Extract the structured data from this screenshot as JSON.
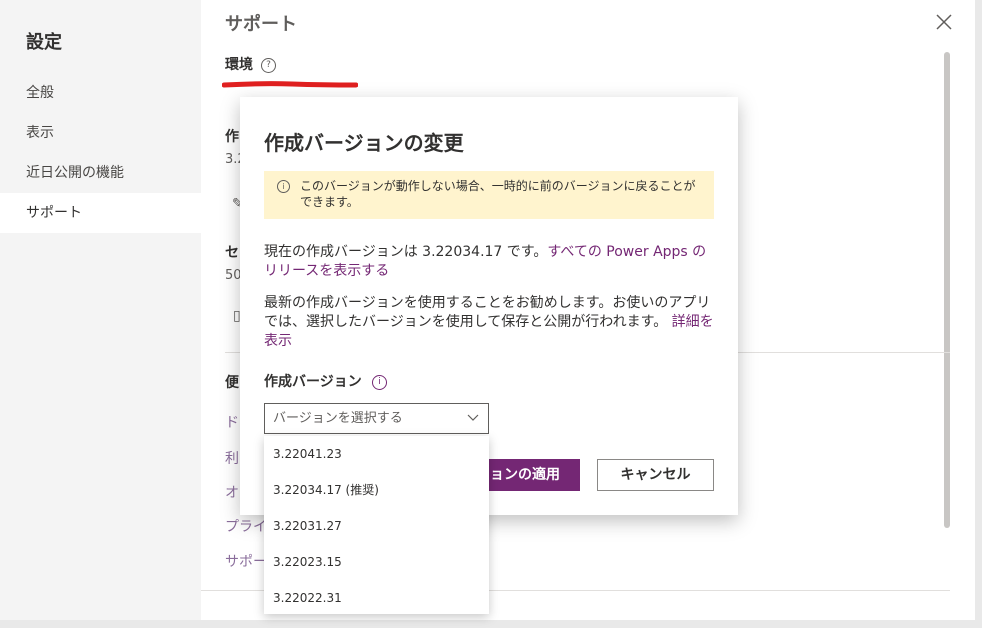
{
  "settings_nav": {
    "title": "設定",
    "items": [
      {
        "label": "全般"
      },
      {
        "label": "表示"
      },
      {
        "label": "近日公開の機能"
      },
      {
        "label": "サポート"
      }
    ]
  },
  "content": {
    "title": "サポート",
    "environment_label": "環境",
    "partial_texts": {
      "authoring": "作",
      "authoring_version": "3.2",
      "session": "セ",
      "session_value": "50",
      "useful": "便",
      "link_do": "ド",
      "link_ri": "利",
      "link_o": "オ",
      "link_privacy": "プライ",
      "link_support": "サポー"
    }
  },
  "dialog": {
    "title": "作成バージョンの変更",
    "warning_text": "このバージョンが動作しない場合、一時的に前のバージョンに戻ることができます。",
    "current_text": "現在の作成バージョンは 3.22034.17 です。",
    "release_link": "すべての Power Apps のリリースを表示する",
    "recommend_text": "最新の作成バージョンを使用することをお勧めします。お使いのアプリでは、選択したバージョンを使用して保存と公開が行われます。",
    "details_link": "詳細を表示",
    "field_label": "作成バージョン",
    "select_placeholder": "バージョンを選択する",
    "apply_label": "ョンの適用",
    "cancel_label": "キャンセル"
  },
  "dropdown_options": [
    {
      "label": "3.22041.23"
    },
    {
      "label": "3.22034.17 (推奨)"
    },
    {
      "label": "3.22031.27"
    },
    {
      "label": "3.22023.15"
    },
    {
      "label": "3.22022.31"
    }
  ],
  "colors": {
    "accent": "#742774",
    "warning_bg": "#fff4ce",
    "redaction": "#e02020"
  }
}
